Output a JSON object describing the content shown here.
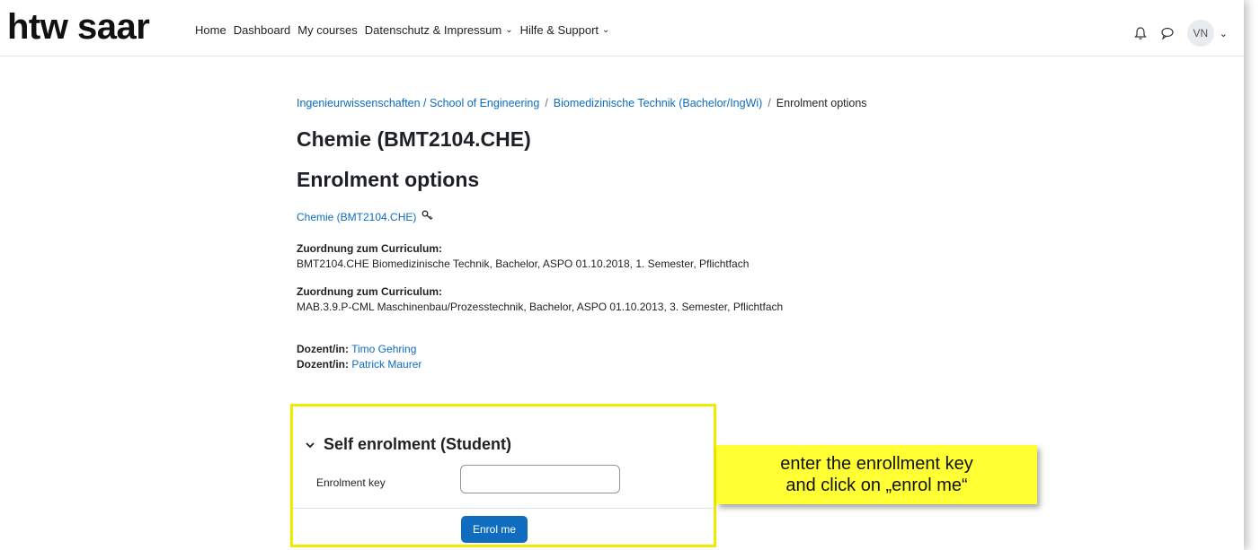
{
  "header": {
    "logo": "htw saar",
    "nav": [
      "Home",
      "Dashboard",
      "My courses",
      "Datenschutz & Impressum",
      "Hilfe & Support"
    ],
    "user_initials": "VN"
  },
  "breadcrumb": [
    "Ingenieurwissenschaften / School of Engineering",
    "Biomedizinische Technik (Bachelor/IngWi)",
    "Enrolment options"
  ],
  "course": {
    "title": "Chemie (BMT2104.CHE)",
    "subtitle": "Enrolment options",
    "link": "Chemie (BMT2104.CHE)"
  },
  "curricula": [
    {
      "label": "Zuordnung zum Curriculum:",
      "text": "BMT2104.CHE Biomedizinische Technik, Bachelor, ASPO 01.10.2018, 1. Semester, Pflichtfach"
    },
    {
      "label": "Zuordnung zum Curriculum:",
      "text": "MAB.3.9.P-CML Maschinenbau/Prozesstechnik, Bachelor, ASPO 01.10.2013, 3. Semester, Pflichtfach"
    }
  ],
  "teachers": [
    {
      "label": "Dozent/in:",
      "name": "Timo Gehring"
    },
    {
      "label": "Dozent/in:",
      "name": "Patrick Maurer"
    }
  ],
  "enrolment": {
    "heading": "Self enrolment (Student)",
    "key_label": "Enrolment key",
    "key_value": "",
    "button": "Enrol me"
  },
  "callout": {
    "line1": "enter the enrollment key",
    "line2": "and click on „enrol me“"
  },
  "icons": {
    "notification": "bell-icon",
    "messages": "chat-icon",
    "key": "key-icon",
    "collapse": "chevron-down-icon"
  },
  "colors": {
    "link": "#0f6cbf",
    "button": "#0f6cbf",
    "highlight": "#ffff33",
    "box_border": "#f0e900"
  }
}
